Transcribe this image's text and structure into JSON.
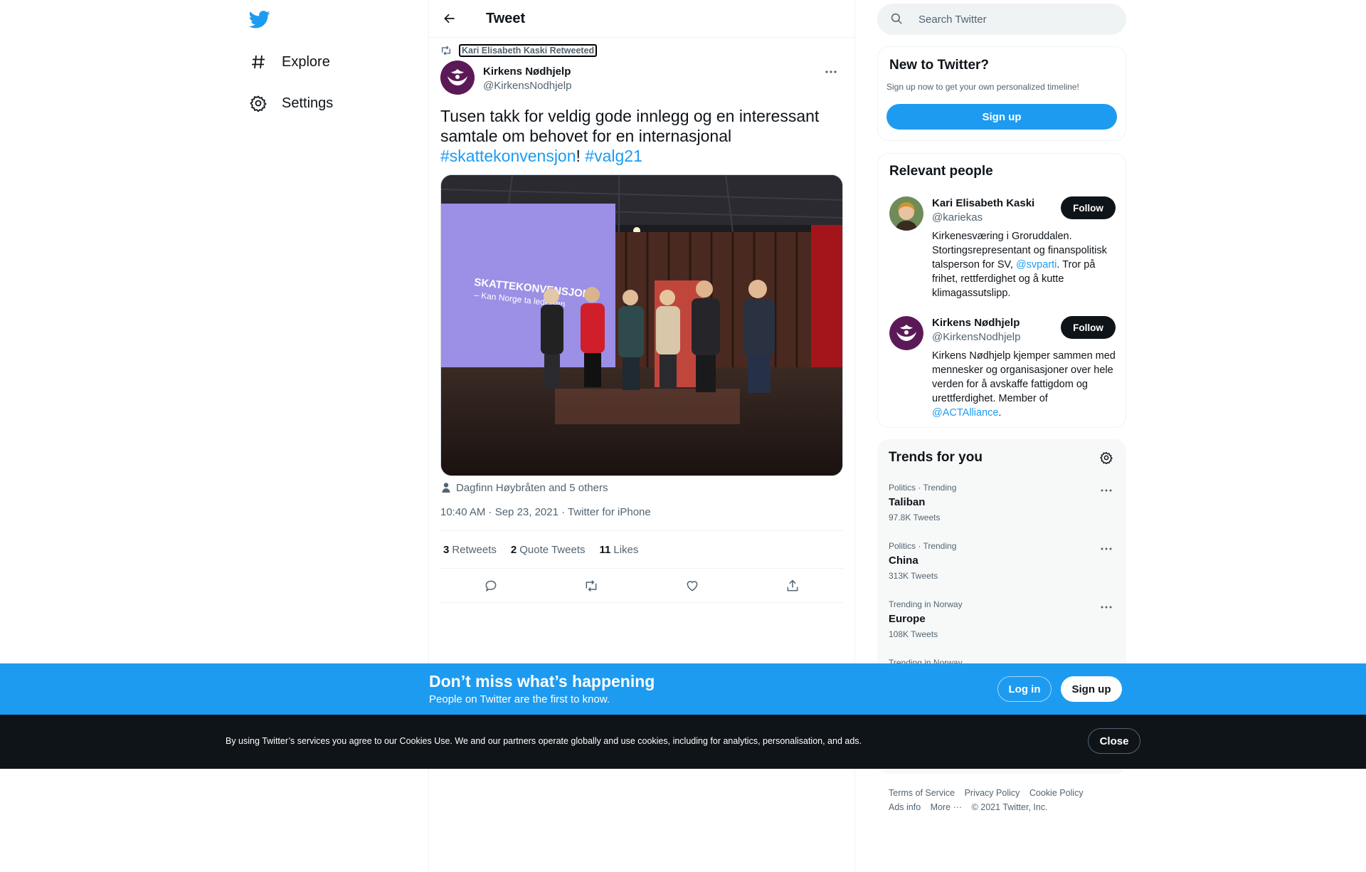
{
  "nav": {
    "items": [
      {
        "label": "Explore",
        "icon": "hashtag-icon"
      },
      {
        "label": "Settings",
        "icon": "gear-icon"
      }
    ]
  },
  "header": {
    "title": "Tweet"
  },
  "tweet": {
    "retweeted_by": "Kari Elisabeth Kaski Retweeted",
    "author_name": "Kirkens Nødhjelp",
    "author_handle": "@KirkensNodhjelp",
    "text_main": "Tusen takk for veldig gode innlegg og en interessant samtale om behovet for en internasjonal",
    "hashtag1": "#skattekonvensjon",
    "exclam": "!",
    "hashtag2": "#valg21",
    "image_slide_text1": "SKATTEKONVENSJON",
    "image_slide_text2": "– Kan Norge ta ledelsen",
    "tagged": "Dagfinn Høybråten and 5 others",
    "timestamp": "10:40 AM · Sep 23, 2021 · Twitter for iPhone",
    "stats": {
      "retweets_count": "3",
      "retweets_label": "Retweets",
      "quotes_count": "2",
      "quotes_label": "Quote Tweets",
      "likes_count": "11",
      "likes_label": "Likes"
    }
  },
  "search": {
    "placeholder": "Search Twitter"
  },
  "new_to_twitter": {
    "title": "New to Twitter?",
    "subtitle": "Sign up now to get your own personalized timeline!",
    "button": "Sign up"
  },
  "relevant_people": {
    "title": "Relevant people",
    "people": [
      {
        "name": "Kari Elisabeth Kaski",
        "handle": "@kariekas",
        "bio_a": "Kirkenesværing i Groruddalen. Stortingsrepresentant og finanspolitisk talsperson for SV, ",
        "bio_link": "@svparti",
        "bio_b": ". Tror på frihet, rettferdighet og å kutte klimagassutslipp.",
        "follow": "Follow"
      },
      {
        "name": "Kirkens Nødhjelp",
        "handle": "@KirkensNodhjelp",
        "bio_a": "Kirkens Nødhjelp kjemper sammen med mennesker og organisasjoner over hele verden for å avskaffe fattigdom og urettferdighet. Member of ",
        "bio_link": "@ACTAlliance",
        "bio_b": ".",
        "follow": "Follow"
      }
    ]
  },
  "trends": {
    "title": "Trends for you",
    "items": [
      {
        "context": "Politics · Trending",
        "name": "Taliban",
        "count": "97.8K Tweets"
      },
      {
        "context": "Politics · Trending",
        "name": "China",
        "count": "313K Tweets"
      },
      {
        "context": "Trending in Norway",
        "name": "Europe",
        "count": "108K Tweets"
      },
      {
        "context": "Trending in Norway",
        "name": "",
        "count": ""
      }
    ]
  },
  "footer": {
    "links": [
      "Terms of Service",
      "Privacy Policy",
      "Cookie Policy",
      "Ads info",
      "More ···",
      "© 2021 Twitter, Inc."
    ]
  },
  "banner": {
    "title": "Don’t miss what’s happening",
    "subtitle": "People on Twitter are the first to know.",
    "login": "Log in",
    "signup": "Sign up"
  },
  "cookie": {
    "text": "By using Twitter’s services you agree to our Cookies Use. We and our partners operate globally and use cookies, including for analytics, personalisation, and ads.",
    "close": "Close"
  },
  "colors": {
    "accent": "#1d9bf0",
    "text": "#0f1419",
    "muted": "#536471",
    "dark": "#0f1419"
  }
}
